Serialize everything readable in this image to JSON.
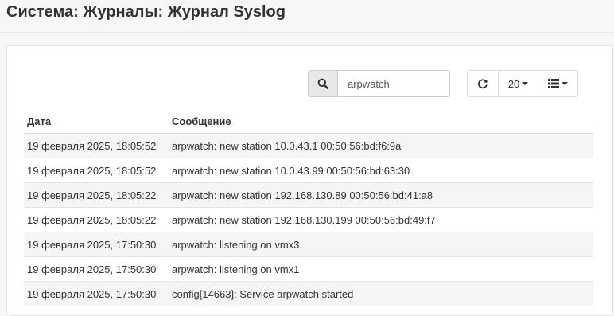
{
  "header": {
    "title": "Система: Журналы: Журнал Syslog"
  },
  "toolbar": {
    "search_icon": "search-icon",
    "search_value": "arpwatch",
    "refresh_icon": "refresh-icon",
    "rows_per_page": "20",
    "columns_icon": "list-icon"
  },
  "table": {
    "headers": [
      "Дата",
      "Сообщение"
    ],
    "rows": [
      {
        "date": "19 февраля 2025, 18:05:52",
        "message": "arpwatch: new station 10.0.43.1 00:50:56:bd:f6:9a"
      },
      {
        "date": "19 февраля 2025, 18:05:52",
        "message": "arpwatch: new station 10.0.43.99 00:50:56:bd:63:30"
      },
      {
        "date": "19 февраля 2025, 18:05:22",
        "message": "arpwatch: new station 192.168.130.89 00:50:56:bd:41:a8"
      },
      {
        "date": "19 февраля 2025, 18:05:22",
        "message": "arpwatch: new station 192.168.130.199 00:50:56:bd:49:f7"
      },
      {
        "date": "19 февраля 2025, 17:50:30",
        "message": "arpwatch: listening on vmx3"
      },
      {
        "date": "19 февраля 2025, 17:50:30",
        "message": "arpwatch: listening on vmx1"
      },
      {
        "date": "19 февраля 2025, 17:50:30",
        "message": "config[14663]: Service arpwatch started"
      }
    ]
  },
  "colors": {
    "row_stripe": "#f5f5f5",
    "addon_bg": "#e8e8e8",
    "text": "#333333"
  }
}
